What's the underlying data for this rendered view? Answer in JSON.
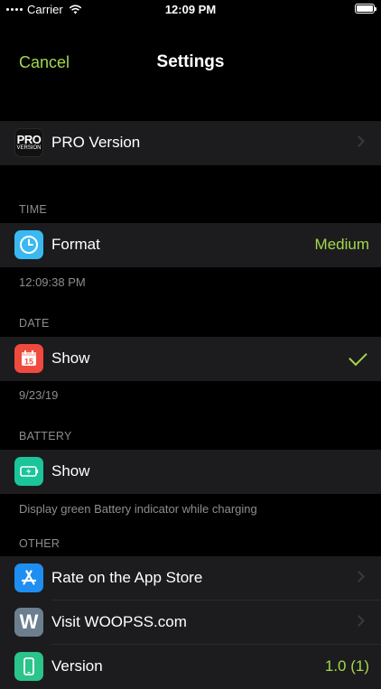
{
  "status_bar": {
    "carrier": "Carrier",
    "time": "12:09 PM"
  },
  "nav": {
    "cancel": "Cancel",
    "title": "Settings"
  },
  "pro": {
    "label": "PRO Version",
    "icon_big": "PRO",
    "icon_small": "VERSION"
  },
  "time_section": {
    "header": "TIME",
    "format_label": "Format",
    "format_value": "Medium",
    "footer": "12:09:38 PM"
  },
  "date_section": {
    "header": "DATE",
    "show_label": "Show",
    "calendar_day": "15",
    "show_checked": true,
    "footer": "9/23/19"
  },
  "battery_section": {
    "header": "BATTERY",
    "show_label": "Show",
    "footer": "Display green Battery indicator while charging"
  },
  "other_section": {
    "header": "OTHER",
    "rate_label": "Rate on the App Store",
    "visit_label": "Visit WOOPSS.com",
    "visit_icon_letter": "W",
    "version_label": "Version",
    "version_value": "1.0 (1)"
  },
  "colors": {
    "accent": "#a3d84b",
    "clock_icon": "#3ab9f0",
    "calendar_icon": "#f04a3e",
    "battery_icon": "#1cc49a",
    "appstore_icon": "#1f8ef1",
    "woopss_icon": "#6c7f8f",
    "version_icon": "#2bc48a"
  }
}
